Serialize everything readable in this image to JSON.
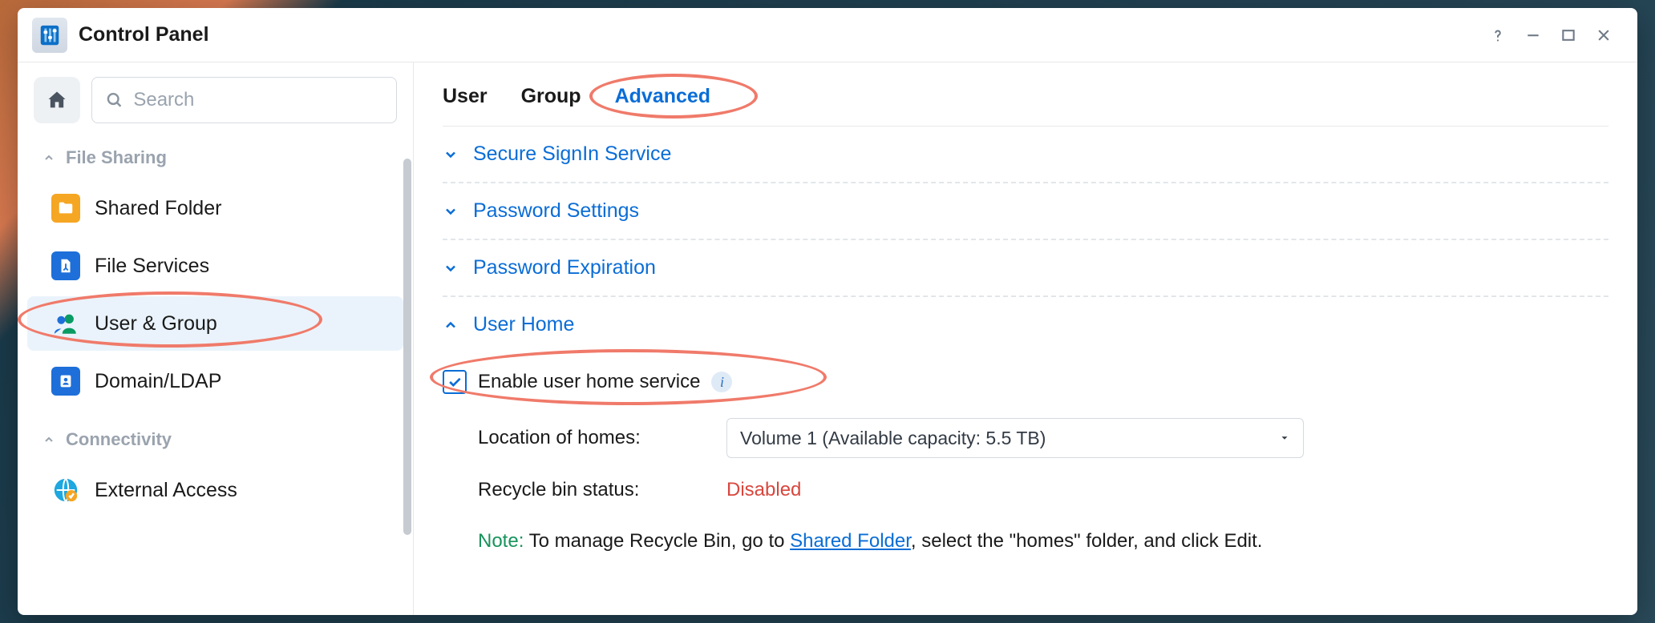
{
  "window": {
    "title": "Control Panel"
  },
  "sidebar": {
    "search_placeholder": "Search",
    "sections": {
      "file_sharing": "File Sharing",
      "connectivity": "Connectivity"
    },
    "items": {
      "shared_folder": "Shared Folder",
      "file_services": "File Services",
      "user_group": "User & Group",
      "domain_ldap": "Domain/LDAP",
      "external_access": "External Access"
    }
  },
  "tabs": {
    "user": "User",
    "group": "Group",
    "advanced": "Advanced"
  },
  "accordion": {
    "secure_signin": "Secure SignIn Service",
    "password_settings": "Password Settings",
    "password_expiration": "Password Expiration",
    "user_home": "User Home"
  },
  "user_home": {
    "enable_label": "Enable user home service",
    "location_label": "Location of homes:",
    "location_value": "Volume 1 (Available capacity:  5.5 TB)",
    "recycle_label": "Recycle bin status:",
    "recycle_value": "Disabled",
    "note_label": "Note:",
    "note_pre": " To manage Recycle Bin, go to ",
    "note_link": "Shared Folder",
    "note_post": ", select the \"homes\" folder, and click Edit."
  }
}
